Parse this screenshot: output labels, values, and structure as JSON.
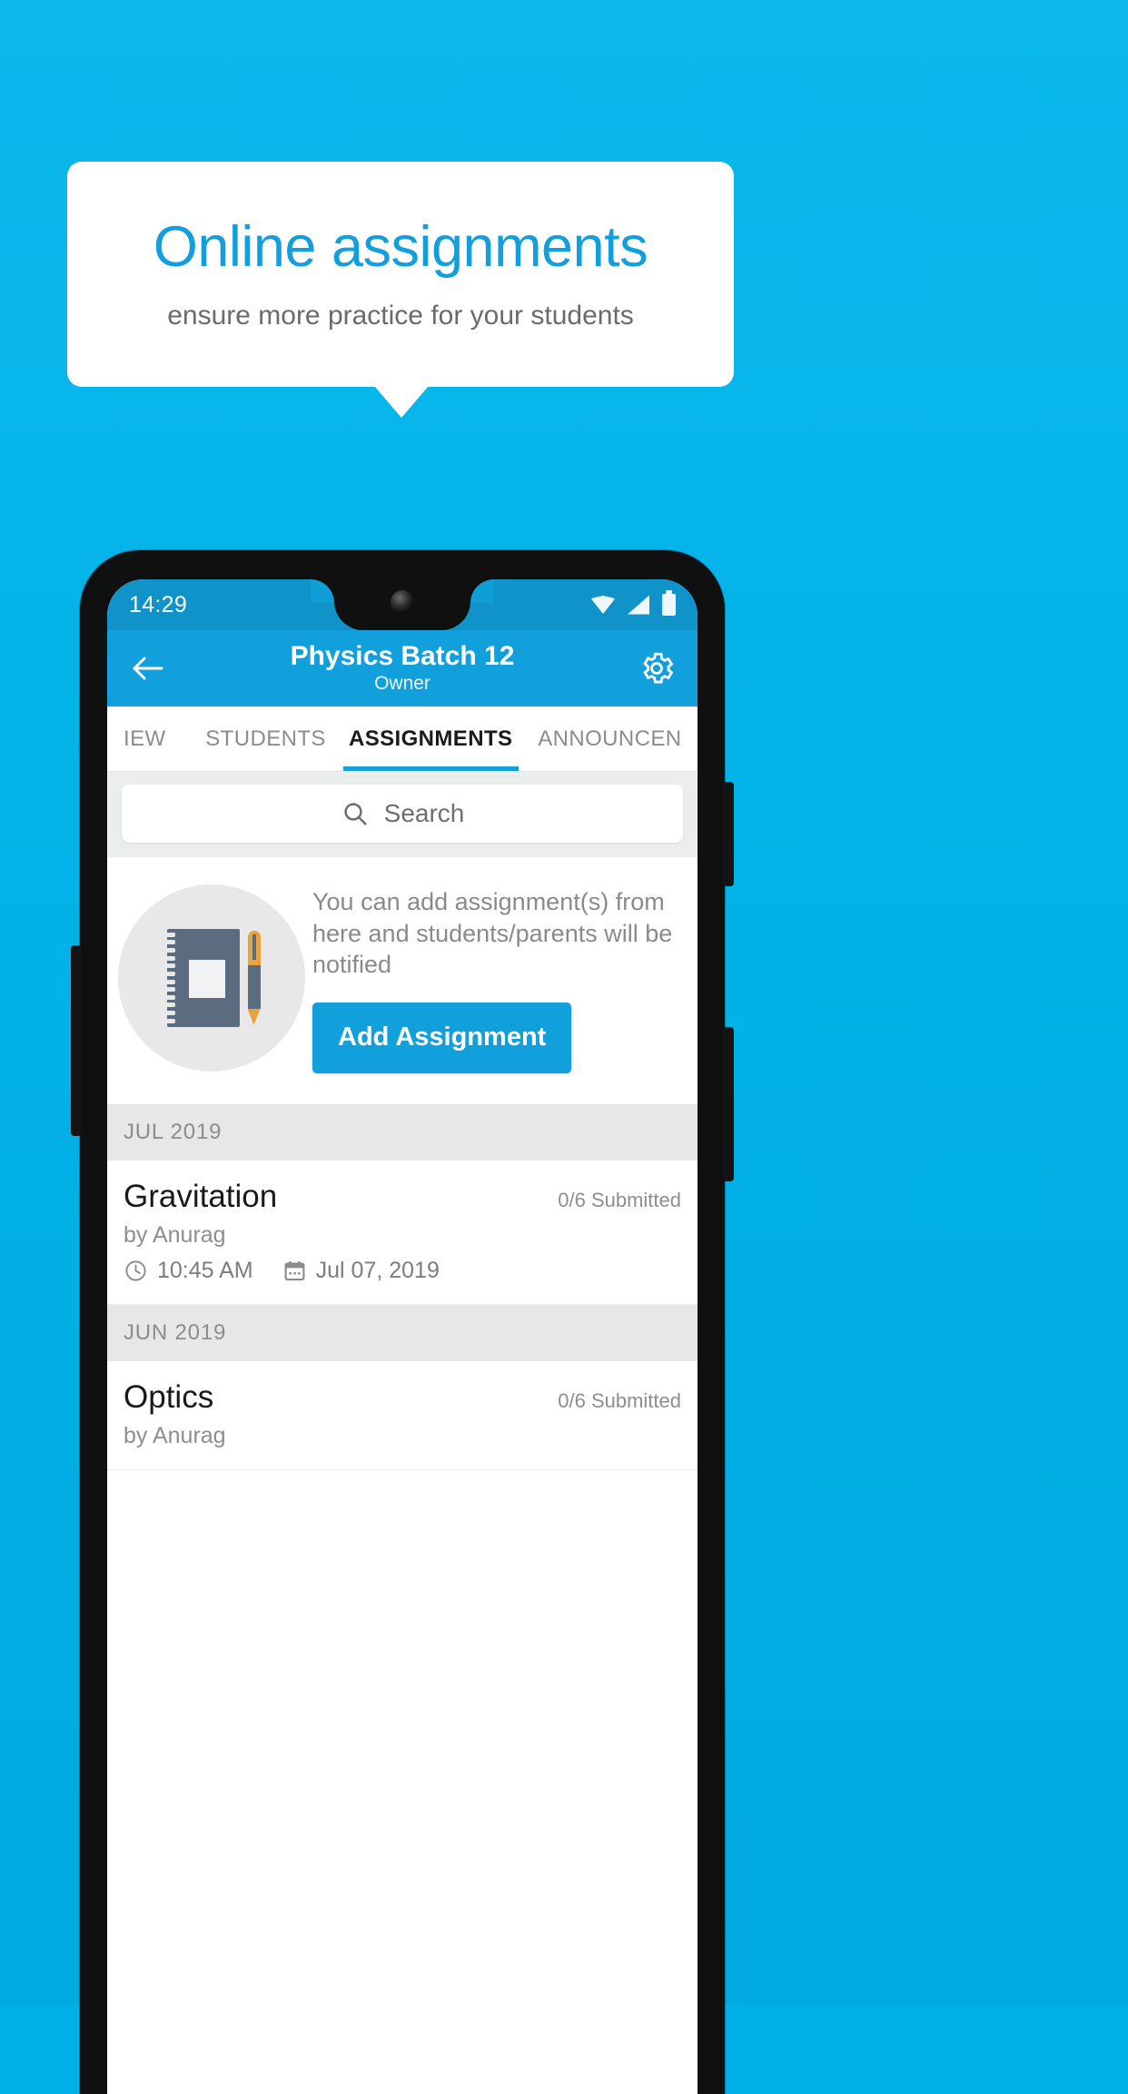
{
  "promo": {
    "title": "Online assignments",
    "subtitle": "ensure more practice for your students"
  },
  "colors": {
    "background": "#00b0e6",
    "accent": "#12a0dc",
    "statusbar": "#0f93c9",
    "card": "#ffffff",
    "muted_text": "#8a8a8a",
    "month_header_bg": "#e7e7e7"
  },
  "phone": {
    "statusbar": {
      "time": "14:29",
      "icons": [
        "wifi-icon",
        "cell-signal-icon",
        "battery-icon"
      ]
    },
    "appbar": {
      "back_icon": "back-arrow-icon",
      "title": "Physics Batch 12",
      "subtitle": "Owner",
      "settings_icon": "gear-icon"
    },
    "tabs": [
      {
        "label": "IEW",
        "active": false
      },
      {
        "label": "STUDENTS",
        "active": false
      },
      {
        "label": "ASSIGNMENTS",
        "active": true
      },
      {
        "label": "ANNOUNCEN",
        "active": false
      }
    ],
    "search": {
      "icon": "search-icon",
      "placeholder": "Search",
      "value": ""
    },
    "empty_state": {
      "illustration": "notebook-and-pen-icon",
      "message": "You can add assignment(s) from here and students/parents will be notified",
      "button_label": "Add Assignment"
    },
    "groups": [
      {
        "month": "JUL 2019",
        "items": [
          {
            "title": "Gravitation",
            "submitted": "0/6 Submitted",
            "author": "by Anurag",
            "time_icon": "clock-icon",
            "time": "10:45 AM",
            "date_icon": "calendar-icon",
            "date": "Jul 07, 2019"
          }
        ]
      },
      {
        "month": "JUN 2019",
        "items": [
          {
            "title": "Optics",
            "submitted": "0/6 Submitted",
            "author": "by Anurag",
            "time_icon": "clock-icon",
            "time": "",
            "date_icon": "calendar-icon",
            "date": ""
          }
        ]
      }
    ]
  }
}
